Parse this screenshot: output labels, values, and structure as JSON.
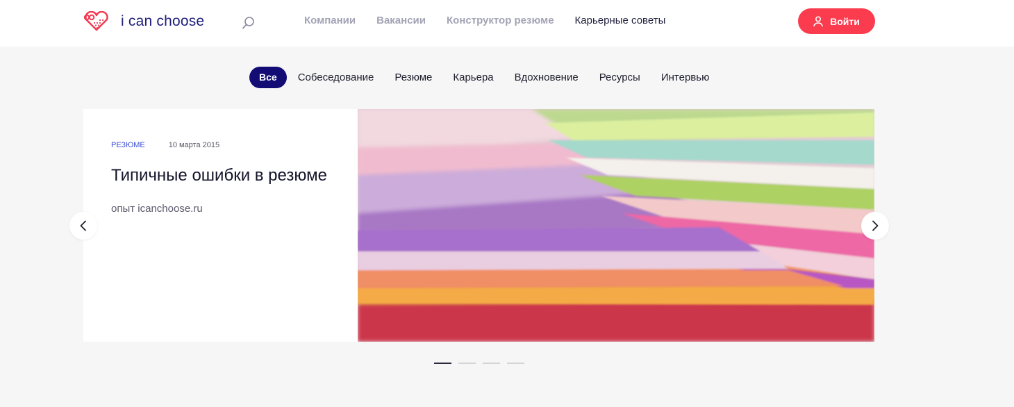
{
  "header": {
    "logo_text": "i can choose",
    "nav": [
      "Компании",
      "Вакансии",
      "Конструктор резюме",
      "Карьерные советы"
    ],
    "nav_active_index": 3,
    "login_label": "Войти"
  },
  "tabs": {
    "items": [
      "Все",
      "Собеседование",
      "Резюме",
      "Карьера",
      "Вдохновение",
      "Ресурсы",
      "Интервью"
    ],
    "active_index": 0
  },
  "slide": {
    "category": "РЕЗЮМЕ",
    "date": "10 марта 2015",
    "title": "Типичные ошибки в резюме",
    "source": "опыт icanchoose.ru"
  },
  "slider": {
    "dot_count": 4,
    "active_dot": 0
  },
  "colors": {
    "accent": "#fb3c4f",
    "brand": "#20207a",
    "tab_active": "#130c75",
    "category_link": "#3a4ed6"
  },
  "icons": {
    "logo": "heart-logo-icon",
    "search": "search-icon",
    "login": "user-icon",
    "prev": "chevron-left-icon",
    "next": "chevron-right-icon"
  }
}
